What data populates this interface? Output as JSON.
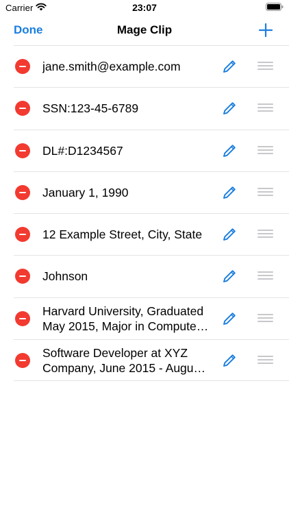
{
  "status_bar": {
    "carrier": "Carrier",
    "time": "23:07"
  },
  "nav": {
    "done_label": "Done",
    "title": "Mage Clip",
    "add_icon": "plus-icon"
  },
  "colors": {
    "accent": "#1a7ee0",
    "delete": "#f23a30",
    "separator": "#e3e3e6",
    "handle": "#c7c7cc"
  },
  "items": [
    {
      "text": "jane.smith@example.com"
    },
    {
      "text": "SSN:123-45-6789"
    },
    {
      "text": "DL#:D1234567"
    },
    {
      "text": "January 1, 1990"
    },
    {
      "text": "12 Example Street, City, State"
    },
    {
      "text": "Johnson"
    },
    {
      "text": "Harvard University, Graduated May 2015, Major in Compute…"
    },
    {
      "text": "Software Developer at XYZ Company, June 2015 - Augu…"
    }
  ]
}
